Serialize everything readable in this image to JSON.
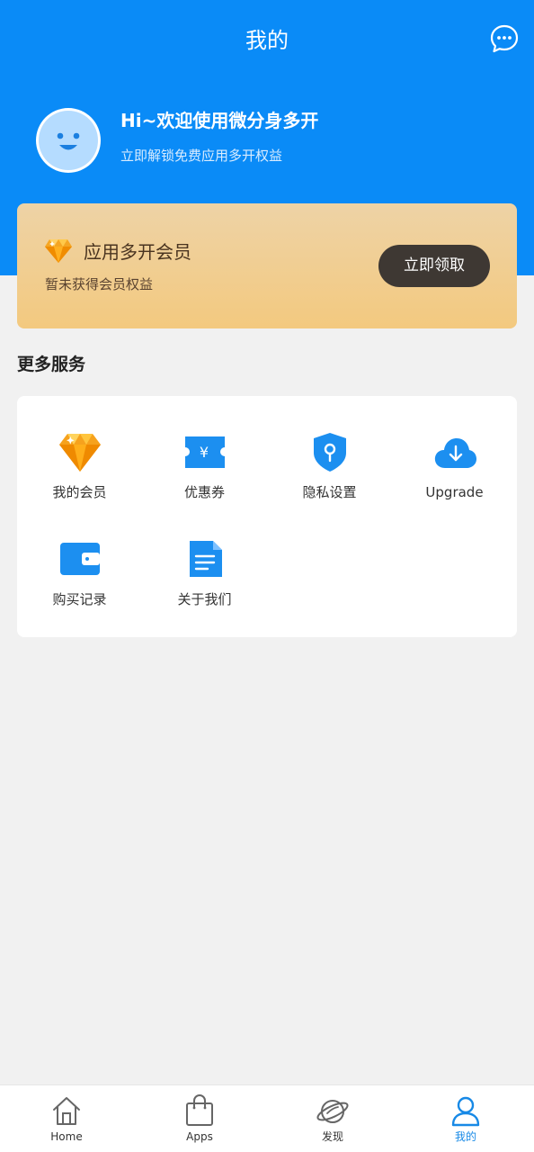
{
  "header": {
    "title": "我的",
    "message_icon": "chat-bubble-icon"
  },
  "profile": {
    "greeting": "Hi~欢迎使用微分身多开",
    "subtitle": "立即解锁免费应用多开权益",
    "avatar_icon": "smiley-face-icon"
  },
  "member_card": {
    "title": "应用多开会员",
    "status": "暂未获得会员权益",
    "button_label": "立即领取",
    "icon": "diamond-icon"
  },
  "more_services": {
    "title": "更多服务",
    "items": [
      {
        "label": "我的会员",
        "icon": "diamond-icon"
      },
      {
        "label": "优惠券",
        "icon": "coupon-icon"
      },
      {
        "label": "隐私设置",
        "icon": "shield-lock-icon"
      },
      {
        "label": "Upgrade",
        "icon": "cloud-download-icon"
      },
      {
        "label": "购买记录",
        "icon": "wallet-icon"
      },
      {
        "label": "关于我们",
        "icon": "document-icon"
      }
    ]
  },
  "bottom_nav": {
    "items": [
      {
        "label": "Home",
        "icon": "home-icon",
        "active": false
      },
      {
        "label": "Apps",
        "icon": "shopping-bag-icon",
        "active": false
      },
      {
        "label": "发现",
        "icon": "planet-icon",
        "active": false
      },
      {
        "label": "我的",
        "icon": "user-icon",
        "active": true
      }
    ]
  },
  "colors": {
    "primary": "#0a8bf7",
    "page_bg": "#f1f1f1",
    "member_gold": "#f3c97f",
    "button_dark": "#3e3833",
    "nav_active": "#1789e6"
  }
}
